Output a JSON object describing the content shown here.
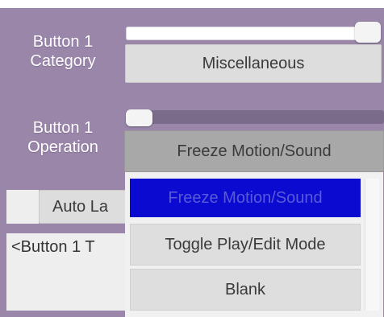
{
  "category": {
    "label": "Button 1\nCategory",
    "slider_level": 0.95,
    "value": "Miscellaneous"
  },
  "operation": {
    "label": "Button 1\nOperation",
    "slider_level": 0.0,
    "value": "Freeze Motion/Sound"
  },
  "auto": {
    "label": "Auto La"
  },
  "button_text": {
    "value": "<Button 1 T"
  },
  "dropdown": {
    "items": [
      {
        "label": "Freeze Motion/Sound",
        "selected": true
      },
      {
        "label": "Toggle Play/Edit Mode",
        "selected": false
      },
      {
        "label": "Blank",
        "selected": false
      }
    ]
  },
  "colors": {
    "panel": "#9a86a9",
    "selected_item": "#0a0ad0"
  }
}
